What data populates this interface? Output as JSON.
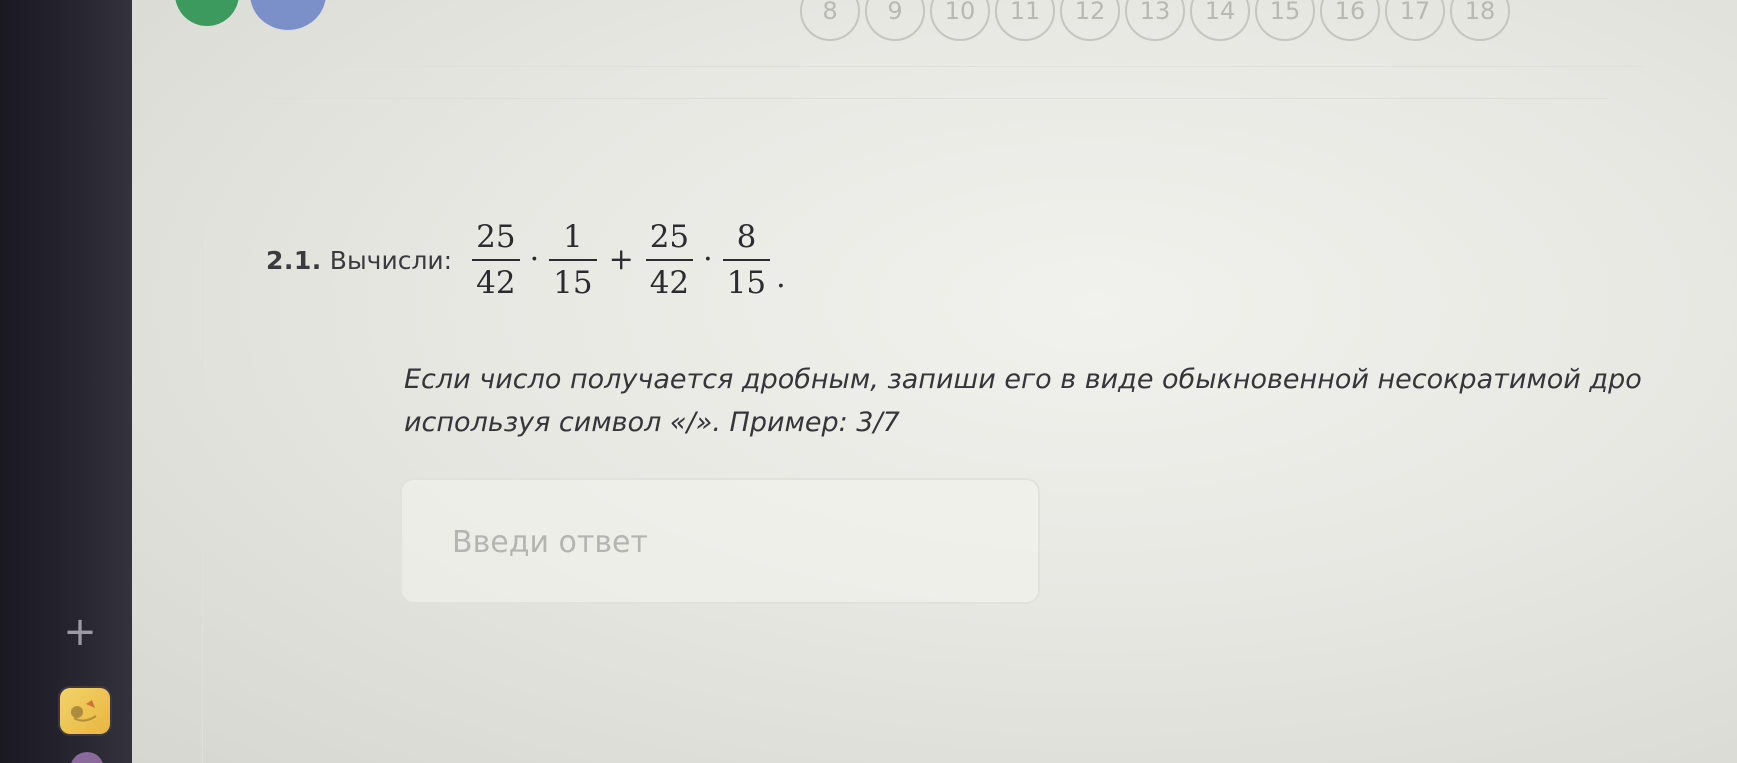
{
  "question_nav": {
    "items": [
      "8",
      "9",
      "10",
      "11",
      "12",
      "13",
      "14",
      "15",
      "16",
      "17",
      "18"
    ]
  },
  "task": {
    "number": "2.1.",
    "verb": "Вычисли:",
    "formula": {
      "frac1": {
        "num": "25",
        "den": "42"
      },
      "op1": "·",
      "frac2": {
        "num": "1",
        "den": "15"
      },
      "op2": "+",
      "frac3": {
        "num": "25",
        "den": "42"
      },
      "op3": "·",
      "frac4": {
        "num": "8",
        "den": "15"
      },
      "end": "."
    }
  },
  "instruction": {
    "line1": "Если число получается дробным, запиши его в виде обыкновенной несократимой дро",
    "line2": "используя символ «/». Пример: 3/7"
  },
  "answer": {
    "value": "",
    "placeholder": "Введи ответ"
  },
  "sidebar": {
    "add_label": "+",
    "app_icon": "sticker-app-icon"
  },
  "colors": {
    "sidebar": "#26252f",
    "nav_green": "#3d9a5e",
    "nav_blue": "#7b8fc8",
    "text": "#35353a",
    "placeholder": "#b4b4b0"
  }
}
